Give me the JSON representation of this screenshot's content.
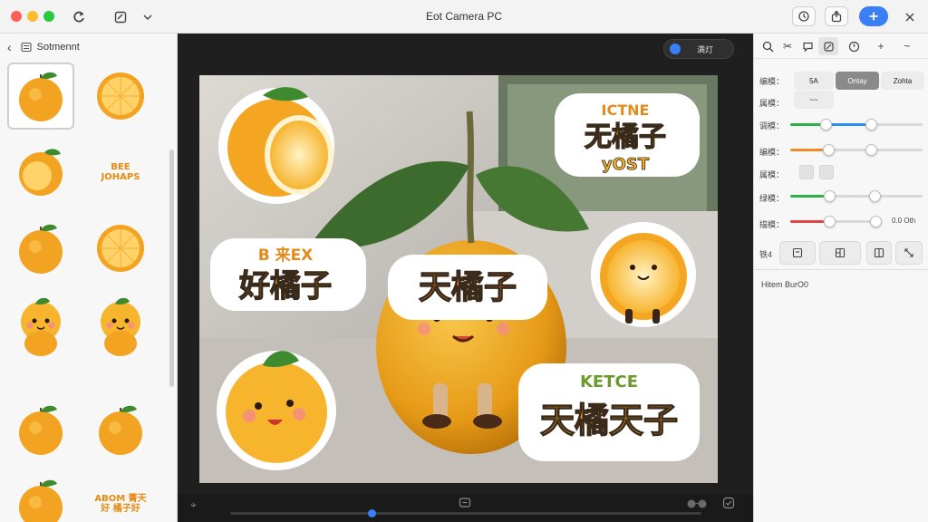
{
  "window": {
    "title": "Eot Camera PC"
  },
  "left_panel": {
    "header_label": "Sotmennt",
    "stickers": [
      {
        "kind": "orange-whole",
        "selected": true
      },
      {
        "kind": "orange-half"
      },
      {
        "kind": "orange-slice"
      },
      {
        "kind": "orange-text",
        "text": "BEE JOHAPS"
      },
      {
        "kind": "orange-whole"
      },
      {
        "kind": "orange-half"
      },
      {
        "kind": "orange-character"
      },
      {
        "kind": "orange-character"
      },
      {
        "kind": "orange-whole"
      },
      {
        "kind": "orange-whole"
      },
      {
        "kind": "orange-whole"
      },
      {
        "kind": "orange-text",
        "text": "ABOM 菁天好 橘子好"
      }
    ]
  },
  "canvas": {
    "pill_label": "满灯",
    "stickers": [
      {
        "text_top": "ICTNE",
        "text_main": "无橘子",
        "text_sub": "yOST"
      },
      {
        "text_top": "B 来EX",
        "text_main": "好橘子"
      },
      {
        "text_main": "天橘子"
      },
      {
        "text_top": "KETCE",
        "text_main": "天橘天子"
      }
    ]
  },
  "right_panel": {
    "rows": [
      {
        "label": "编模：",
        "segments": [
          "5A",
          "Ontay",
          "Zohta"
        ],
        "active_segment": 1
      },
      {
        "label": "属模：",
        "segments": [
          "~~"
        ]
      },
      {
        "label": "调模：",
        "color": "#2bb34a",
        "color2": "#2f8ff0",
        "knob1": 0.27,
        "knob2": 0.61
      },
      {
        "label": "编模：",
        "color": "#f08a2a",
        "knob1": 0.24,
        "knob2": 0.61
      },
      {
        "label": "属模："
      },
      {
        "label": "绿模：",
        "color": "#2bb34a",
        "knob1": 0.25,
        "knob2": 0.64
      },
      {
        "label": "描模：",
        "color": "#e04545",
        "knob1": 0.25,
        "knob2": 0.65,
        "value": "0.0 Oth"
      }
    ],
    "icon_row_label": "铁4",
    "info_text": "Hitem BurO0"
  }
}
